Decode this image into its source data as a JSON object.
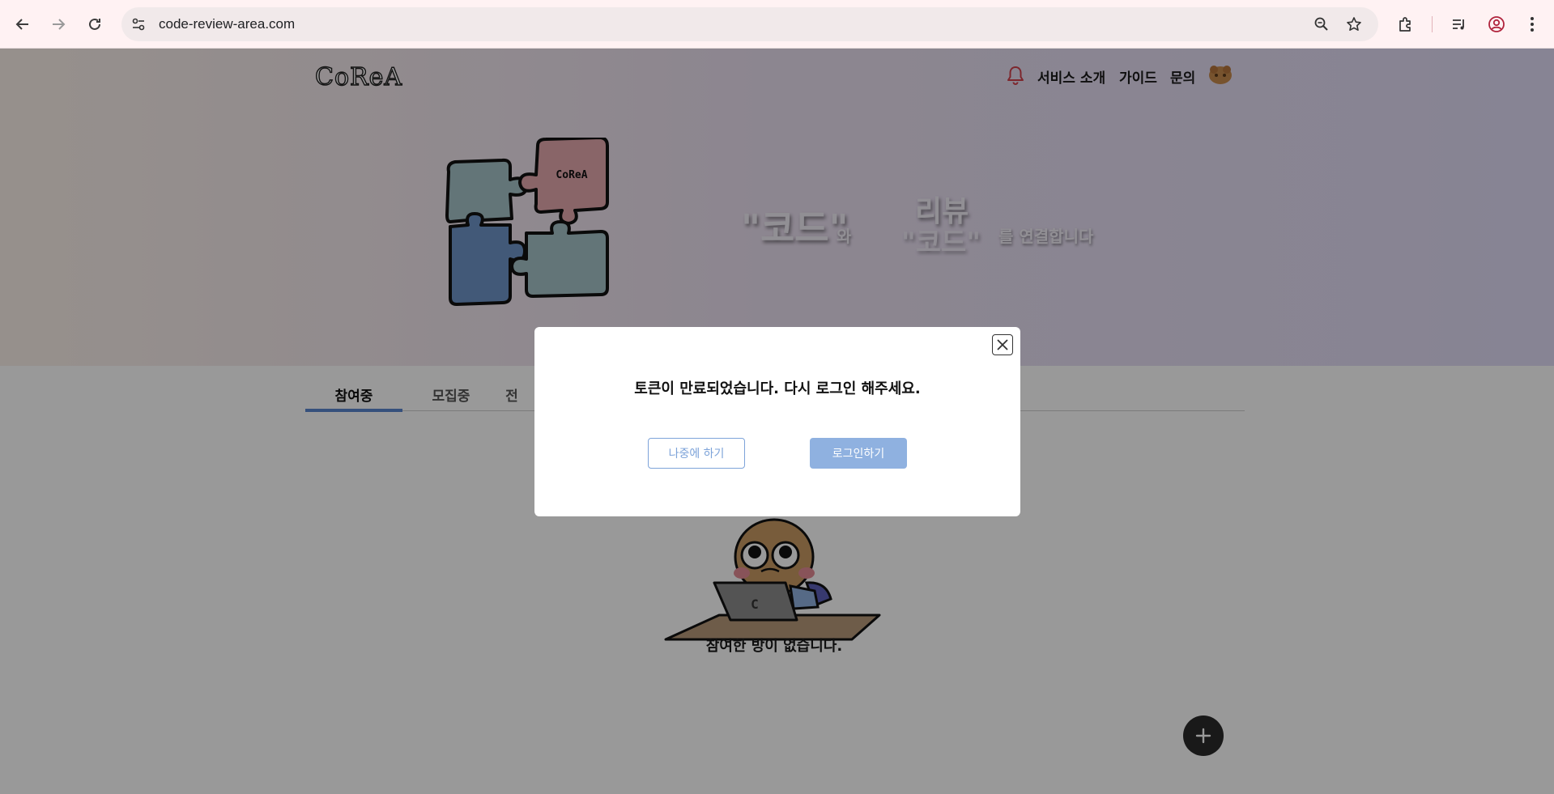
{
  "browser": {
    "url": "code-review-area.com",
    "icons": {
      "back": "arrow-left-icon",
      "forward": "arrow-right-icon",
      "reload": "reload-icon",
      "site_info": "tune-icon",
      "zoom": "zoom-icon",
      "bookmark": "star-icon",
      "extensions": "puzzle-icon",
      "media": "media-control-icon",
      "profile": "profile-icon",
      "menu": "kebab-menu-icon"
    }
  },
  "header": {
    "logo": "CoReA",
    "nav": [
      "서비스 소개",
      "가이드",
      "문의"
    ],
    "accent_bell_color": "#d0414b"
  },
  "hero": {
    "puzzle_label": "CoReA",
    "slogan": {
      "word1": "\"코드\"",
      "conj1": "와",
      "word2_top": "리뷰",
      "word2_bottom": "\"코드\"",
      "rest": "를 연결합니다"
    }
  },
  "tabs": [
    {
      "label": "참여중",
      "active": true
    },
    {
      "label": "모집중",
      "active": false
    },
    {
      "label": "전",
      "active": false
    }
  ],
  "empty_state": {
    "message": "참여한 방이 없습니다.",
    "laptop_letter": "C"
  },
  "fab": {
    "icon": "plus-icon"
  },
  "modal": {
    "message": "토큰이 만료되었습니다. 다시 로그인 해주세요.",
    "later_label": "나중에 하기",
    "login_label": "로그인하기",
    "close_icon": "close-icon",
    "accent_color": "#8fb1e0"
  }
}
